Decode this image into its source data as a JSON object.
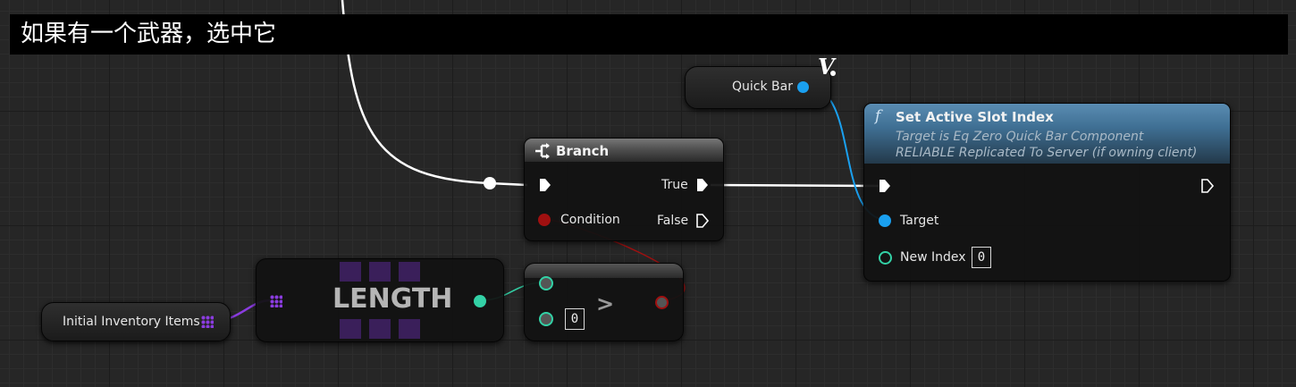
{
  "comment": {
    "text": "如果有一个武器，选中它"
  },
  "quick_bar_node": {
    "label": "Quick Bar",
    "variable_glyph": "V"
  },
  "branch_node": {
    "title": "Branch",
    "icon": "branch-icon",
    "pins": {
      "true_label": "True",
      "condition_label": "Condition",
      "false_label": "False"
    }
  },
  "set_active_slot_node": {
    "title": "Set Active Slot Index",
    "function_glyph": "f",
    "subtitle_line1": "Target is Eq Zero Quick Bar Component",
    "subtitle_line2": "RELIABLE Replicated To Server (if owning client)",
    "pins": {
      "target_label": "Target",
      "new_index_label": "New Index",
      "new_index_value": "0"
    },
    "header_color": "#3f6f93"
  },
  "length_node": {
    "label": "LENGTH",
    "array_color": "#7b2fbe"
  },
  "greater_node": {
    "operator": ">",
    "b_value": "0"
  },
  "inventory_node": {
    "label": "Initial Inventory Items"
  },
  "colors": {
    "exec_wire": "#ffffff",
    "object_pin": "#1aa0f0",
    "bool_pin": "#a01010",
    "int_pin": "#33d1a6",
    "array_pin": "#8b3ce0"
  }
}
